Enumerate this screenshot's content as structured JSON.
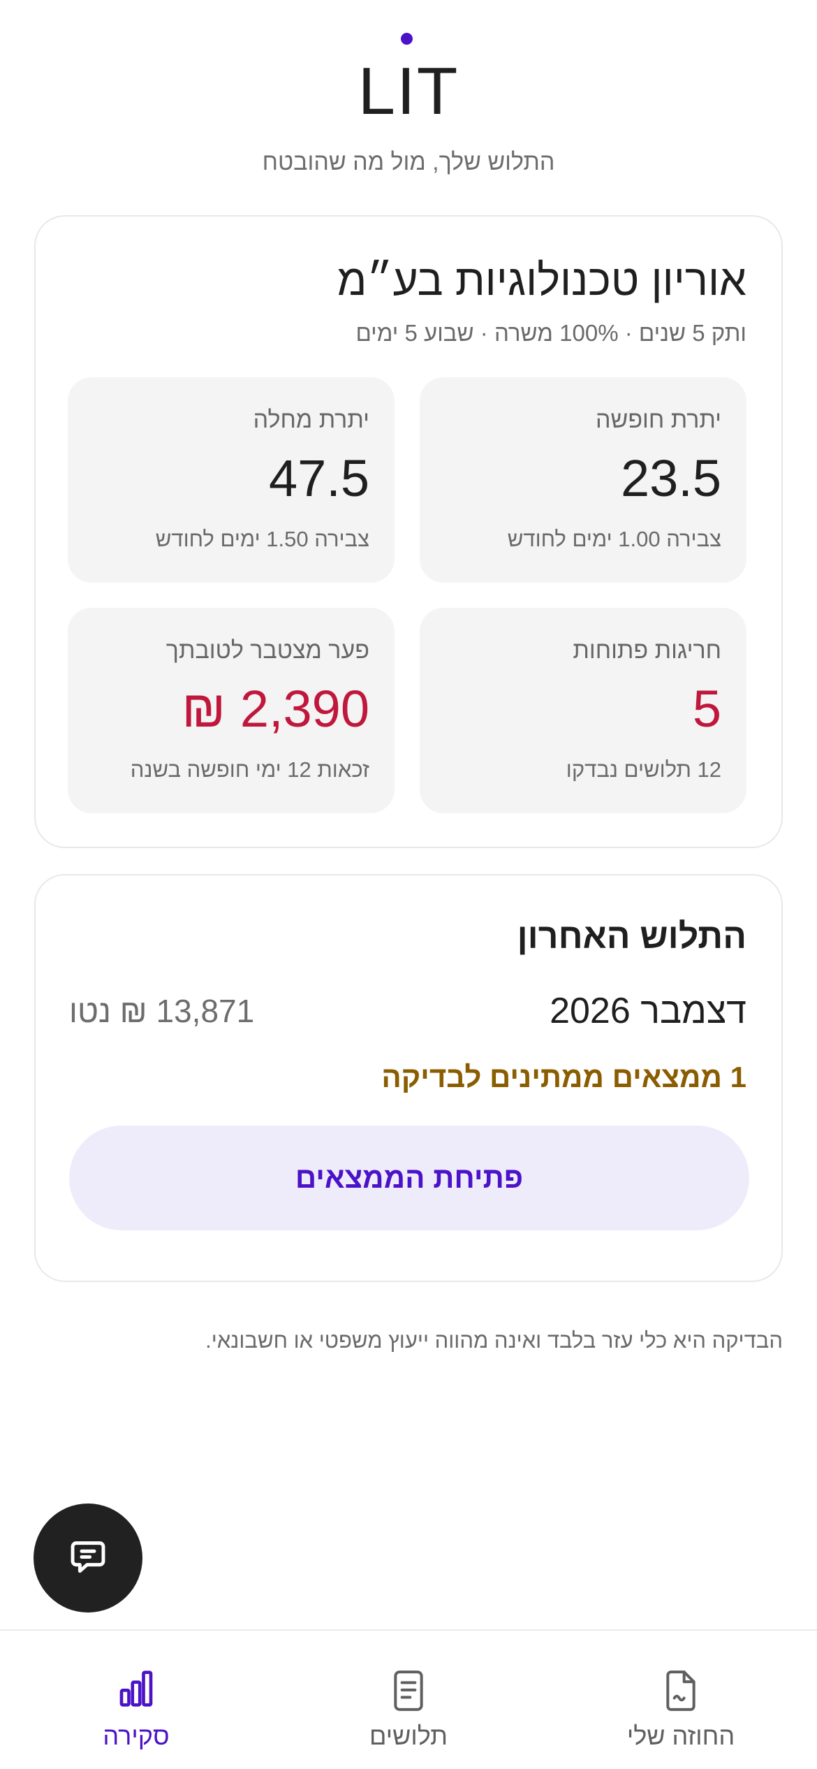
{
  "header": {
    "brand": "LIT",
    "tagline": "התלוש שלך, מול מה שהובטח",
    "accent_color": "#4b12c8"
  },
  "employer_card": {
    "company": "אוריון טכנולוגיות בע״מ",
    "terms": "ותק 5 שנים · 100% משרה · שבוע 5 ימים",
    "tiles": [
      {
        "label": "יתרת חופשה",
        "value": "23.5",
        "sub": "צבירה 1.00 ימים לחודש"
      },
      {
        "label": "יתרת מחלה",
        "value": "47.5",
        "sub": "צבירה 1.50 ימים לחודש"
      },
      {
        "label": "חריגות פתוחות",
        "value": "5",
        "sub": "12 תלושים נבדקו",
        "color": "#c0173c"
      },
      {
        "label": "פער מצטבר לטובתך",
        "value": "2,390 ₪",
        "sub": "זכאות 12 ימי חופשה בשנה",
        "color": "#c0173c"
      }
    ]
  },
  "last_payslip": {
    "title": "התלוש האחרון",
    "month": "דצמבר 2026",
    "net": "13,871 ₪ נטו",
    "pending": "1 ממצאים ממתינים לבדיקה",
    "pending_color": "#8a5d00",
    "button_label": "פתיחת הממצאים"
  },
  "disclaimer": "הבדיקה היא כלי עזר בלבד ואינה מהווה ייעוץ משפטי או חשבונאי.",
  "chat_button": {
    "icon": "chat-icon"
  },
  "bottom_nav": [
    {
      "label": "החוזה שלי",
      "icon": "document-icon",
      "active": false
    },
    {
      "label": "תלושים",
      "icon": "list-document-icon",
      "active": false
    },
    {
      "label": "סקירה",
      "icon": "bar-chart-icon",
      "active": true
    }
  ]
}
